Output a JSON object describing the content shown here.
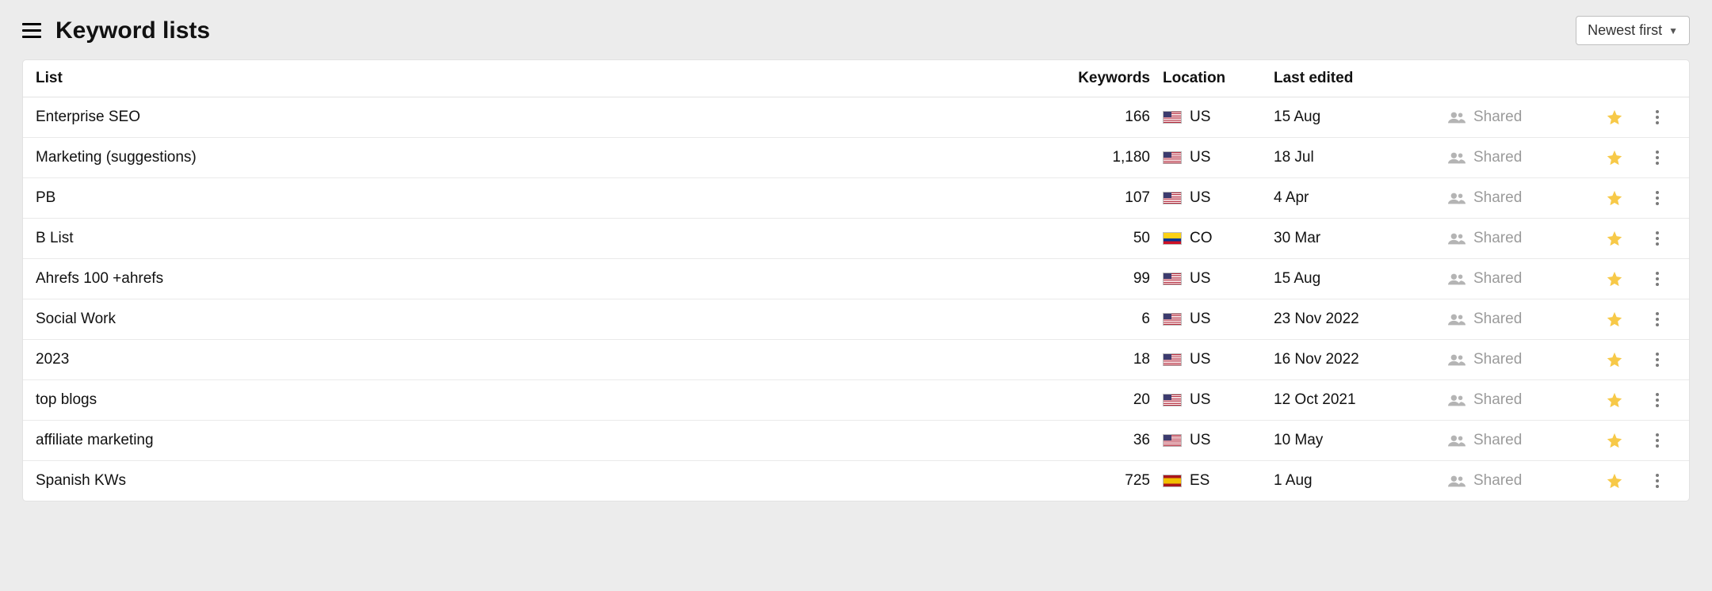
{
  "header": {
    "title": "Keyword lists",
    "sort_label": "Newest first"
  },
  "columns": {
    "list": "List",
    "keywords": "Keywords",
    "location": "Location",
    "last_edited": "Last edited"
  },
  "shared_label": "Shared",
  "rows": [
    {
      "name": "Enterprise SEO",
      "keywords": "166",
      "country_code": "US",
      "flag_class": "us",
      "last_edited": "15 Aug",
      "shared": true,
      "starred": true
    },
    {
      "name": "Marketing (suggestions)",
      "keywords": "1,180",
      "country_code": "US",
      "flag_class": "us",
      "last_edited": "18 Jul",
      "shared": true,
      "starred": true
    },
    {
      "name": "PB",
      "keywords": "107",
      "country_code": "US",
      "flag_class": "us",
      "last_edited": "4 Apr",
      "shared": true,
      "starred": true
    },
    {
      "name": "B List",
      "keywords": "50",
      "country_code": "CO",
      "flag_class": "co",
      "last_edited": "30 Mar",
      "shared": true,
      "starred": true
    },
    {
      "name": "Ahrefs 100 +ahrefs",
      "keywords": "99",
      "country_code": "US",
      "flag_class": "us",
      "last_edited": "15 Aug",
      "shared": true,
      "starred": true
    },
    {
      "name": "Social Work",
      "keywords": "6",
      "country_code": "US",
      "flag_class": "us",
      "last_edited": "23 Nov 2022",
      "shared": true,
      "starred": true
    },
    {
      "name": "2023",
      "keywords": "18",
      "country_code": "US",
      "flag_class": "us",
      "last_edited": "16 Nov 2022",
      "shared": true,
      "starred": true
    },
    {
      "name": "top blogs",
      "keywords": "20",
      "country_code": "US",
      "flag_class": "us",
      "last_edited": "12 Oct 2021",
      "shared": true,
      "starred": true
    },
    {
      "name": "affiliate marketing",
      "keywords": "36",
      "country_code": "US",
      "flag_class": "us",
      "last_edited": "10 May",
      "shared": true,
      "starred": true
    },
    {
      "name": "Spanish KWs",
      "keywords": "725",
      "country_code": "ES",
      "flag_class": "es",
      "last_edited": "1 Aug",
      "shared": true,
      "starred": true
    }
  ]
}
